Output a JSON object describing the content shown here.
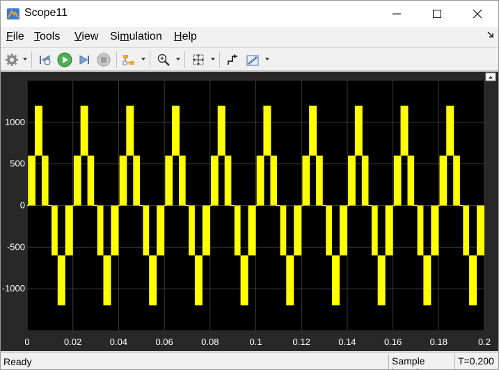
{
  "window": {
    "title": "Scope11"
  },
  "menu": [
    {
      "key": "F",
      "rest": "ile"
    },
    {
      "key": "T",
      "rest": "ools"
    },
    {
      "key": "V",
      "rest": "iew"
    },
    {
      "pre": "Si",
      "key": "m",
      "rest": "ulation"
    },
    {
      "key": "H",
      "rest": "elp"
    }
  ],
  "toolbar": {
    "icons": [
      "settings-icon",
      "step-back-icon",
      "run-icon",
      "step-forward-icon",
      "stop-icon",
      "highlight-icon",
      "zoom-icon",
      "fit-view-icon",
      "triggers-icon",
      "measurements-icon"
    ]
  },
  "status": {
    "text": "Ready",
    "mode": "Sample based",
    "time": "T=0.200"
  },
  "colors": {
    "signal": "#ffff00",
    "plot_bg": "#000000",
    "frame_bg": "#282828",
    "grid": "#3c3c3c",
    "tick_text": "#ffffff"
  },
  "chart_data": {
    "type": "line",
    "title": "",
    "xlabel": "",
    "ylabel": "",
    "xlim": [
      0,
      0.2
    ],
    "ylim": [
      -1500,
      1500
    ],
    "xticks": [
      0,
      0.02,
      0.04,
      0.06,
      0.08,
      0.1,
      0.12,
      0.14,
      0.16,
      0.18,
      0.2
    ],
    "xtick_labels": [
      "0",
      "0.02",
      "0.04",
      "0.06",
      "0.08",
      "0.1",
      "0.12",
      "0.14",
      "0.16",
      "0.18",
      "0.2"
    ],
    "yticks": [
      1000,
      500,
      0,
      -500,
      -1000
    ],
    "ytick_labels": [
      "1000",
      "500",
      "0",
      "-500",
      "-1000"
    ],
    "grid": true,
    "series": [
      {
        "period": 0.02,
        "levels": [
          0,
          600,
          1200,
          600,
          0,
          -600,
          -1200,
          -600
        ],
        "level_starts": [
          0,
          0.00067,
          0.00333,
          0.00667,
          0.009,
          0.01067,
          0.01333,
          0.01667
        ],
        "pwm_dense": true
      }
    ]
  }
}
